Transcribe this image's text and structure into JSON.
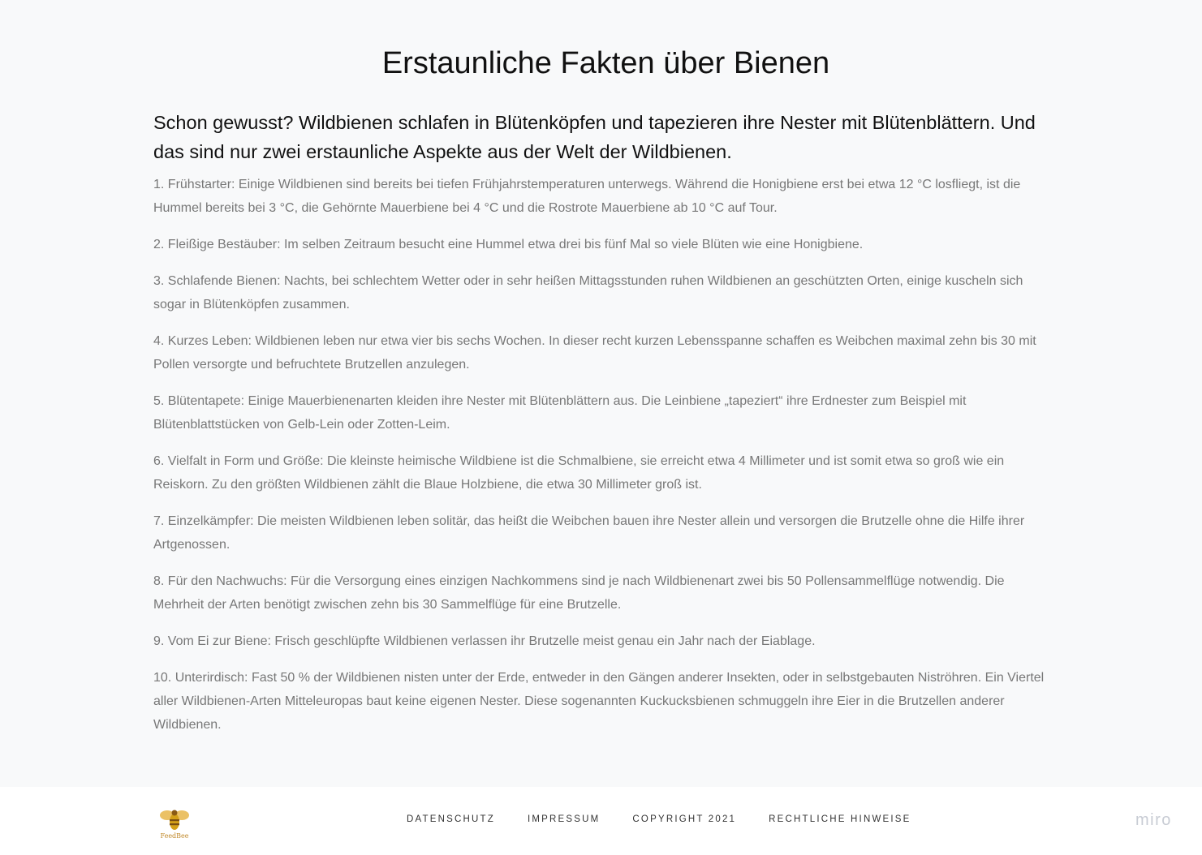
{
  "article": {
    "title": "Erstaunliche Fakten über Bienen",
    "lead": "Schon gewusst? Wildbienen schlafen in Blütenköpfen und tapezieren ihre Nester mit Blütenblättern. Und das sind nur zwei erstaunliche Aspekte aus der Welt der Wildbienen.",
    "facts": [
      "1. Frühstarter: Einige Wildbienen sind bereits bei tiefen Frühjahrstemperaturen unterwegs. Während die Honigbiene erst bei etwa 12 °C losfliegt, ist die Hummel bereits bei 3 °C, die Gehörnte Mauerbiene bei 4 °C und die Rostrote Mauerbiene ab 10 °C auf Tour.",
      "2. Fleißige Bestäuber: Im selben Zeitraum besucht eine Hummel etwa drei bis fünf Mal so viele Blüten wie eine Honigbiene.",
      "3. Schlafende Bienen: Nachts, bei schlechtem Wetter oder in sehr heißen Mittagsstunden ruhen Wildbienen an geschützten Orten, einige kuscheln sich sogar in Blütenköpfen zusammen.",
      "4. Kurzes Leben: Wildbienen leben nur etwa vier bis sechs Wochen. In dieser recht kurzen Lebensspanne schaffen es Weibchen maximal zehn bis 30 mit Pollen versorgte und befruchtete Brutzellen anzulegen.",
      "5. Blütentapete: Einige Mauerbienenarten kleiden ihre Nester mit Blütenblättern aus. Die Leinbiene „tapeziert“ ihre Erdnester zum Beispiel mit Blütenblattstücken von Gelb-Lein oder Zotten-Leim.",
      "6. Vielfalt in Form und Größe: Die kleinste heimische Wildbiene ist die Schmalbiene, sie erreicht etwa 4 Millimeter und ist somit etwa so groß wie ein Reiskorn. Zu den größten Wildbienen zählt die Blaue Holzbiene, die etwa 30 Millimeter groß ist.",
      "7. Einzelkämpfer: Die meisten Wildbienen leben solitär, das heißt die Weibchen bauen ihre Nester allein und versorgen die Brutzelle ohne die Hilfe ihrer Artgenossen.",
      "8. Für den Nachwuchs: Für die Versorgung eines einzigen Nachkommens sind je nach Wildbienenart zwei bis 50 Pollensammelflüge notwendig. Die Mehrheit der Arten benötigt zwischen zehn bis 30 Sammelflüge für eine Brutzelle.",
      "9. Vom Ei zur Biene: Frisch geschlüpfte Wildbienen verlassen ihr Brutzelle meist genau ein Jahr nach der Eiablage.",
      "10. Unterirdisch: Fast 50 % der Wildbienen nisten unter der Erde, entweder in den Gängen anderer Insekten, oder in selbstgebauten Niströhren. Ein Viertel aller Wildbienen-Arten Mitteleuropas baut keine eigenen Nester. Diese sogenannten Kuckucksbienen schmuggeln ihre Eier in die Brutzellen anderer Wildbienen."
    ]
  },
  "footer": {
    "logo_icon": "bee-logo-icon",
    "logo_text": "FeedBee",
    "links": [
      "DATENSCHUTZ",
      "IMPRESSUM",
      "COPYRIGHT 2021",
      "RECHTLICHE HINWEISE"
    ],
    "watermark": "miro"
  },
  "colors": {
    "background": "#f8f9fa",
    "heading": "#111111",
    "body_text": "#777777",
    "logo_gold": "#d4a017"
  }
}
